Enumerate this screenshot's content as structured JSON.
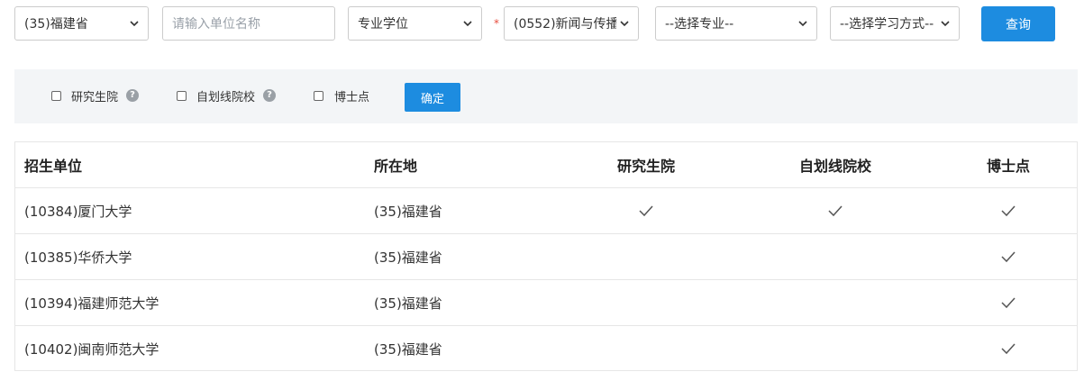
{
  "search": {
    "province": "(35)福建省",
    "unit_placeholder": "请输入单位名称",
    "degree_type": "专业学位",
    "discipline": "(0552)新闻与传播",
    "major": "--选择专业--",
    "study_mode": "--选择学习方式--",
    "required_mark": "*",
    "query_label": "查询"
  },
  "filters": {
    "graduate_school": "研究生院",
    "self_line": "自划线院校",
    "doctoral": "博士点",
    "help_glyph": "?",
    "confirm_label": "确定"
  },
  "table": {
    "headers": [
      "招生单位",
      "所在地",
      "研究生院",
      "自划线院校",
      "博士点"
    ],
    "rows": [
      {
        "unit": "(10384)厦门大学",
        "location": "(35)福建省",
        "graduate_school": true,
        "self_line": true,
        "doctoral": true
      },
      {
        "unit": "(10385)华侨大学",
        "location": "(35)福建省",
        "graduate_school": false,
        "self_line": false,
        "doctoral": true
      },
      {
        "unit": "(10394)福建师范大学",
        "location": "(35)福建省",
        "graduate_school": false,
        "self_line": false,
        "doctoral": true
      },
      {
        "unit": "(10402)闽南师范大学",
        "location": "(35)福建省",
        "graduate_school": false,
        "self_line": false,
        "doctoral": true
      }
    ]
  },
  "colors": {
    "primary": "#1d8ce0",
    "required": "#e74c3c",
    "filter_background": "#f3f5f7"
  },
  "icons": {
    "dropdown": "chevron-down-icon",
    "check": "check-icon",
    "help": "help-icon"
  }
}
